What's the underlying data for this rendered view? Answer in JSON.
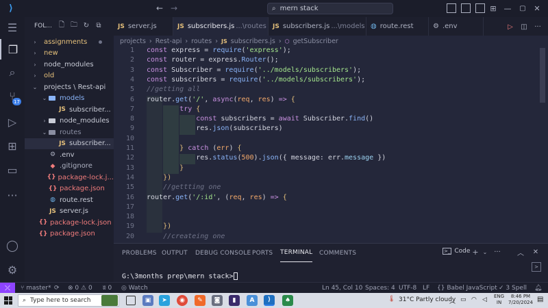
{
  "titlebar": {
    "search_text": "mern stack"
  },
  "sidebar": {
    "header": "FOL...",
    "items": [
      {
        "label": "assignments",
        "type": "folder",
        "depth": 0,
        "expanded": false,
        "color": "#e5c07b",
        "modified": true
      },
      {
        "label": "new",
        "type": "folder",
        "depth": 0,
        "expanded": false,
        "color": "#e5c07b"
      },
      {
        "label": "node_modules",
        "type": "folder",
        "depth": 0,
        "expanded": false,
        "color": "#c8cbd6"
      },
      {
        "label": "old",
        "type": "folder",
        "depth": 0,
        "expanded": false,
        "color": "#e5c07b"
      },
      {
        "label": "projects \\ Rest-api",
        "type": "folder",
        "depth": 0,
        "expanded": true,
        "color": "#c8cbd6"
      },
      {
        "label": "models",
        "type": "folder",
        "depth": 1,
        "expanded": true,
        "color": "#8ab4f8"
      },
      {
        "label": "subscriber...",
        "type": "js",
        "depth": 2
      },
      {
        "label": "node_modules",
        "type": "folder",
        "depth": 1,
        "expanded": false,
        "color": "#c8cbd6"
      },
      {
        "label": "routes",
        "type": "folder",
        "depth": 1,
        "expanded": true,
        "color": "#8a8ea2"
      },
      {
        "label": "subscriber...",
        "type": "js",
        "depth": 2,
        "selected": true
      },
      {
        "label": ".env",
        "type": "env",
        "depth": 1
      },
      {
        "label": ".gitignore",
        "type": "git",
        "depth": 1
      },
      {
        "label": "package-lock.j...",
        "type": "json",
        "depth": 1
      },
      {
        "label": "package.json",
        "type": "json",
        "depth": 1
      },
      {
        "label": "route.rest",
        "type": "rest",
        "depth": 1
      },
      {
        "label": "server.js",
        "type": "js",
        "depth": 1
      },
      {
        "label": "package-lock.json",
        "type": "json",
        "depth": 0
      },
      {
        "label": "package.json",
        "type": "json",
        "depth": 0
      }
    ]
  },
  "tabs": [
    {
      "label": "server.js",
      "dim": "",
      "icon": "JS",
      "active": false
    },
    {
      "label": "subscribers.js",
      "dim": "...\\routes",
      "icon": "JS",
      "active": true
    },
    {
      "label": "subscribers.js",
      "dim": "...\\models",
      "icon": "JS",
      "active": false
    },
    {
      "label": "route.rest",
      "dim": "",
      "icon": "globe",
      "active": false
    },
    {
      "label": ".env",
      "dim": "",
      "icon": "gear",
      "active": false
    }
  ],
  "breadcrumbs": [
    "projects",
    "Rest-api",
    "routes",
    "subscribers.js",
    "getSubscriber"
  ],
  "code_lines": [
    {
      "n": "1",
      "html": "<span class='kw'>const</span> express = <span class='fn'>require</span>(<span class='str'>'express'</span>);"
    },
    {
      "n": "2",
      "html": "<span class='kw'>const</span> router = express.<span class='fn'>Router</span>();"
    },
    {
      "n": "3",
      "html": "<span class='kw'>const</span> Subscriber = <span class='fn'>require</span>(<span class='str'>'../models/subscribers'</span>);"
    },
    {
      "n": "4",
      "html": "<span class='kw'>const</span> subscribers = <span class='fn'>require</span>(<span class='str'>'../models/subscribers'</span>);"
    },
    {
      "n": "5",
      "html": "<span class='cmt'>//getting all</span>"
    },
    {
      "n": "6",
      "html": "router.<span class='fn'>get</span>(<span class='str'>'/'</span>, <span class='kw'>async</span>(<span class='var'>req</span>, <span class='var'>res</span>) <span class='kw'>=&gt;</span> <span class='pn'>{</span>"
    },
    {
      "n": "7",
      "html": "        <span class='kw'>try</span> <span class='pn'>{</span>"
    },
    {
      "n": "8",
      "html": "            <span class='kw'>const</span> subscribers = <span class='kw'>await</span> Subscriber.<span class='fn'>find</span>()"
    },
    {
      "n": "9",
      "html": "            res.<span class='fn'>json</span>(subscribers)"
    },
    {
      "n": "10",
      "html": ""
    },
    {
      "n": "11",
      "html": "        <span class='pn'>}</span> <span class='kw'>catch</span> (<span class='var'>err</span>) <span class='pn'>{</span>"
    },
    {
      "n": "12",
      "html": "            res.<span class='fn'>status</span>(<span class='num'>500</span>).<span class='fn'>json</span>({ message: err.<span class='prop'>message</span> })"
    },
    {
      "n": "13",
      "html": "        <span class='pn'>}</span>"
    },
    {
      "n": "14",
      "html": "    <span class='pn'>})</span>"
    },
    {
      "n": "15",
      "html": "    <span class='cmt'>//gettting one</span>"
    },
    {
      "n": "16",
      "html": "router.<span class='fn'>get</span>(<span class='str'>'/:id'</span>, (<span class='var'>req</span>, <span class='var'>res</span>) <span class='kw'>=&gt;</span> <span class='pn'>{</span>"
    },
    {
      "n": "17",
      "html": ""
    },
    {
      "n": "18",
      "html": ""
    },
    {
      "n": "19",
      "html": "    <span class='pn'>})</span>"
    },
    {
      "n": "20",
      "html": "    <span class='cmt'>//createing one</span>"
    }
  ],
  "panel": {
    "tabs": [
      "PROBLEMS",
      "OUTPUT",
      "DEBUG CONSOLE",
      "PORTS",
      "TERMINAL",
      "COMMENTS"
    ],
    "active_tab": "TERMINAL",
    "terminal_profile": "Code",
    "terminal_line": "G:\\3months prep\\mern stack>"
  },
  "statusbar": {
    "branch": "master*",
    "errors": "0",
    "warnings": "0",
    "info": "0",
    "watch": "Watch",
    "position": "Ln 45, Col 10",
    "spaces": "Spaces: 4",
    "encoding": "UTF-8",
    "eol": "LF",
    "language": "Babel JavaScript",
    "spell": "3 Spell"
  },
  "activity": {
    "source_control_badge": "17"
  },
  "taskbar": {
    "search_placeholder": "Type here to search",
    "weather": "31°C  Partly cloudy",
    "lang_top": "ENG",
    "lang_bottom": "IN",
    "time": "8:46 PM",
    "date": "7/20/2024"
  },
  "colors": {
    "accent": "#8e44ff",
    "badge": "#3c7ee8"
  }
}
